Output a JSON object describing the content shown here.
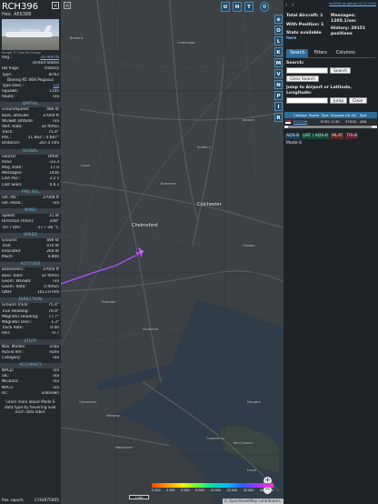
{
  "left": {
    "callsign": "RCH396",
    "hex_line": "Hex: AE6388",
    "close": "×",
    "photo_credit": "Image © Charlie Chang",
    "reg": {
      "k": "Reg.:",
      "v": "20-46076"
    },
    "country": "United States",
    "db_flags": {
      "k": "DB flags:",
      "v": "military"
    },
    "type": {
      "k": "Type:",
      "v": "B762"
    },
    "type_desc_name": "Boeing KC-46A Pegasus",
    "type_desc": {
      "k": "Type Desc.:",
      "v": "L2J"
    },
    "squawk": {
      "k": "Squawk:",
      "v": "1145"
    },
    "route": {
      "k": "Route:",
      "v": "n/a"
    },
    "spatial": {
      "title": "SPATIAL",
      "rows": [
        {
          "k": "Groundspeed:",
          "v": "486 kt"
        },
        {
          "k": "Baro. altitude:",
          "v": "37000 ft"
        },
        {
          "k": "WGS84 altitude:",
          "v": "n/a"
        },
        {
          "k": "Vert. Rate:",
          "v": "32 ft/min"
        },
        {
          "k": "Track:",
          "v": "75.4°"
        },
        {
          "k": "Pos.:",
          "v": "51.842°, 0.687°"
        },
        {
          "k": "Distance:",
          "v": "207.5 nmi"
        }
      ]
    },
    "signal": {
      "title": "SIGNAL",
      "rows": [
        {
          "k": "Source:",
          "v": "Other"
        },
        {
          "k": "RSSI:",
          "v": "-23.3"
        },
        {
          "k": "Msg. Rate:",
          "v": "17.0"
        },
        {
          "k": "Messages:",
          "v": "1456"
        },
        {
          "k": "Last Pos.:",
          "v": "3.2 s"
        },
        {
          "k": "Last Seen:",
          "v": "0.6 s"
        }
      ]
    },
    "fms": {
      "title": "FMS SEL",
      "rows": [
        {
          "k": "Sel. Alt.:",
          "v": "37008 ft"
        },
        {
          "k": "Sel. Head.:",
          "v": "n/a"
        }
      ]
    },
    "wind": {
      "title": "WIND",
      "rows": [
        {
          "k": "Speed:",
          "v": "31 kt"
        },
        {
          "k": "Direction (from):",
          "v": "208°"
        },
        {
          "k": "TAT / OAT:",
          "v": "-17 / -46 °C"
        }
      ]
    },
    "speed": {
      "title": "SPEED",
      "rows": [
        {
          "k": "Ground:",
          "v": "486 kt"
        },
        {
          "k": "True:",
          "v": "470 kt"
        },
        {
          "k": "Indicated:",
          "v": "260 kt"
        },
        {
          "k": "Mach:",
          "v": "0.800"
        }
      ]
    },
    "altitude": {
      "title": "ALTITUDE",
      "rows": [
        {
          "k": "Barometric:",
          "v": "37000 ft"
        },
        {
          "k": "Baro. Rate:",
          "v": "32 ft/min"
        },
        {
          "k": "Geom. WGS84:",
          "v": "n/a"
        },
        {
          "k": "Geom. Rate:",
          "v": "0 ft/min"
        },
        {
          "k": "QNH:",
          "v": "1013.0 hPa"
        }
      ]
    },
    "direction": {
      "title": "DIRECTION",
      "rows": [
        {
          "k": "Ground Track:",
          "v": "75.4°"
        },
        {
          "k": "True Heading:",
          "v": "76.9°"
        },
        {
          "k": "Magnetic Heading:",
          "v": "77.7°"
        },
        {
          "k": "Magnetic Decl.:",
          "v": "1.3°"
        },
        {
          "k": "Track Rate:",
          "v": "0.00"
        },
        {
          "k": "Roll:",
          "v": "-0.7"
        }
      ]
    },
    "stuff": {
      "title": "STUFF",
      "rows": [
        {
          "k": "Nav. Modes:",
          "v": "vnav"
        },
        {
          "k": "ADS-B Ver.:",
          "v": "none"
        },
        {
          "k": "Category:",
          "v": "n/a"
        }
      ]
    },
    "accuracy": {
      "title": "ACCURACY",
      "rows": [
        {
          "k": "NACp:",
          "v": "n/a"
        },
        {
          "k": "SIL:",
          "v": "n/a"
        },
        {
          "k": "NICbaro:",
          "v": "n/a"
        },
        {
          "k": "NACv:",
          "v": "n/a"
        },
        {
          "k": "Rc:",
          "v": "unknown"
        }
      ]
    },
    "note": "Learn more about Mode S data type by hovering over each data label.",
    "epoch": {
      "k": "Pos. epoch:",
      "v": "1744975605"
    }
  },
  "map": {
    "top_buttons": [
      "U",
      "H",
      "T"
    ],
    "side_buttons": [
      "O",
      "L",
      "K",
      "M",
      "V",
      "N",
      "P",
      "I",
      "R"
    ],
    "places": [
      {
        "name": "Bedford"
      },
      {
        "name": "Cambridge"
      },
      {
        "name": "Luton"
      },
      {
        "name": "Chelmsford"
      },
      {
        "name": "Colchester"
      },
      {
        "name": "Ipswich"
      },
      {
        "name": "Sudbury"
      },
      {
        "name": "Braintree"
      },
      {
        "name": "Clacton"
      },
      {
        "name": "Southend"
      },
      {
        "name": "Margate"
      },
      {
        "name": "Canterbury"
      },
      {
        "name": "Kent Downs"
      },
      {
        "name": "Maidstone"
      },
      {
        "name": "Gravesend"
      },
      {
        "name": "Dover"
      },
      {
        "name": "Medway"
      },
      {
        "name": "Basildon"
      }
    ],
    "zoom_in": "+",
    "zoom_out": "−",
    "scale": "1 km",
    "alt_ticks": [
      "2 000",
      "4 000",
      "6 000",
      "8 000",
      "10 000",
      "20 000",
      "30 000",
      "40 000 ft"
    ],
    "attribution": "© OpenStreetMap contributors.",
    "colors": {
      "track": "#b44bff",
      "aircraft": "#c86bff"
    }
  },
  "right": {
    "top_link": "tar1090 on github (3.14.1700)",
    "stats": {
      "total": "Total Aircraft: 1",
      "with_pos": "With Position: 1",
      "stats_available": "Stats available",
      "stats_link": "here",
      "messages": "Messages: 1205.1/sec",
      "history": "History: 29151 positions"
    },
    "tabs": [
      "Search",
      "Filters",
      "Columns"
    ],
    "search_label": "Search:",
    "search_button": "Search",
    "clear_search": "Clear Search",
    "jump_label": "Jump to Airport or Latitude, Longitude:",
    "jump_button": "Jump",
    "clear_button": "Clear",
    "list_headers": [
      "",
      "Callsign",
      "Route",
      "Type",
      "Squawk",
      "Alt (ft)",
      "Spd"
    ],
    "list_row": {
      "callsign": "RCH396",
      "route": "",
      "type": "B762",
      "squawk": "1145",
      "alt": "37000",
      "spd": "486"
    },
    "sources": [
      "ADS-B",
      "UAT / ADS-R",
      "MLAT",
      "TIS-B",
      "Mode-S"
    ]
  }
}
